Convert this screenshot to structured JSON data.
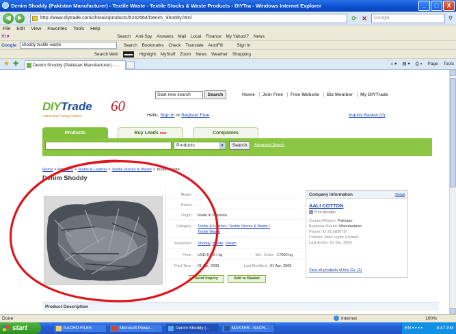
{
  "window": {
    "title": "Denim Shoddy (Pakistan Manufacturer) - Textile Waste - Textile Stocks & Waste Products - DIYTra - Windows Internet Explorer",
    "minimize": "_",
    "maximize": "□",
    "close": "X"
  },
  "address": {
    "url": "http://www.diytrade.com/china/4/products/5242564/Denim_Shoddy.html",
    "search_placeholder": "Google"
  },
  "menu": [
    "File",
    "Edit",
    "View",
    "Favorites",
    "Tools",
    "Help"
  ],
  "yahoo_toolbar": [
    "Search",
    "Anti-Spy",
    "Answers",
    "Mail",
    "Local",
    "Finance",
    "My Yahoo!7",
    "News"
  ],
  "google_toolbar": {
    "logo": "Google",
    "query": "shoddy textile waste",
    "items": [
      "Search",
      "Bookmarks",
      "Check",
      "Translate",
      "AutoFill",
      "Sign In"
    ]
  },
  "web_toolbar": {
    "search_label": "Search Web",
    "items": [
      "Highlight",
      "MyStuff",
      "Zoom",
      "News",
      "Weather",
      "Shopping"
    ]
  },
  "tab": {
    "title": "Denim Shoddy (Pakistan Manufacturer) - ...",
    "commands": [
      "Page",
      "Tools"
    ]
  },
  "site": {
    "new_search_placeholder": "Start new search",
    "search_button": "Search",
    "top_links": [
      "Home",
      "Join Free",
      "Free Website",
      "Biz Member",
      "My DIYTrade"
    ],
    "logo_diy": "DIY",
    "logo_trade": "Trade",
    "logo_60": "60",
    "logo_tagline": "Global B2B Trading Platform",
    "hello_prefix": "Hello,",
    "sign_in": "Sign In",
    "or": "or",
    "register": "Register Free",
    "inquiry_basket": "Inquiry Basket (0)"
  },
  "nav": {
    "tabs": [
      "Products",
      "Buy Leads",
      "Companies"
    ],
    "buy_leads_badge": "new",
    "category_select": "Products",
    "search_button": "Search",
    "advanced": "Advanced Search"
  },
  "breadcrumb": {
    "links": [
      "Home",
      "Products",
      "Textile & Leather",
      "Textile Stocks & Waste"
    ],
    "sep": " > ",
    "current": "Textile Waste"
  },
  "product": {
    "title": "Denim Shoddy",
    "model_label": "Model :",
    "model": "-",
    "brand_label": "Brand :",
    "brand": "-",
    "origin_label": "Origin :",
    "origin": "Made in Pakistan",
    "category_label": "Category :",
    "category_line1": "Textile & Leather / Textile Stocks & Waste /",
    "category_line2": "Textile Waste",
    "keywords_label": "Keywords :",
    "keywords": [
      "Shoddy",
      "Waste",
      "Denim"
    ],
    "price_label": "Price :",
    "price": "USD $ 0.3 / kg",
    "min_order_label": "Min. Order :",
    "min_order": "17000 kg",
    "post_time_label": "Post Time :",
    "post_time": "01 Apr, 2009",
    "modified_label": "Last Modified :",
    "modified": "01 Apr, 2009",
    "send_inquiry": "Send Inquiry",
    "add_basket": "Add to Basket"
  },
  "company": {
    "header": "Company Information",
    "detail": "Detail",
    "name": "AALI COTTON",
    "member": "Free Member",
    "country_label": "Country/Region:",
    "country": "Pakistan",
    "nature_label": "Business Nature:",
    "nature": "Manufacturer",
    "phone_label": "Phone:",
    "phone": "92 21 5830797",
    "contact_label": "Contact:",
    "contact": "Moin Hyder (Owner)",
    "active_label": "Last Active:",
    "active": "20 Jun, 2009",
    "view_all": "View all products of this Co. (2)"
  },
  "description_header": "Product Description",
  "status": {
    "left": "Done",
    "zone": "Internet",
    "zoom": "100%"
  },
  "taskbar": {
    "start": "start",
    "items": [
      "NACRO FILES",
      "Microsoft Power...",
      "Denim Shoddy (...",
      "MASTER - NACR..."
    ],
    "lang": "EN",
    "time": "8:47 PM"
  },
  "colors": {
    "accent_green": "#8ac642",
    "annotation_red": "#e0121a",
    "link_blue": "#1f47b8"
  }
}
